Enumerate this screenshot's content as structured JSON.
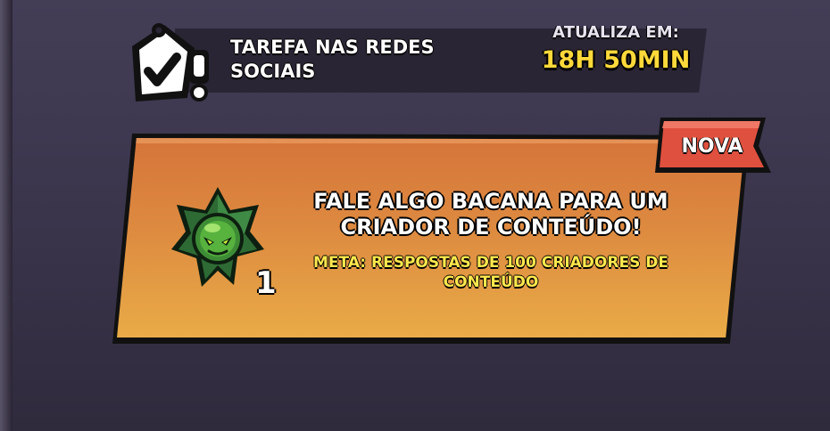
{
  "header": {
    "title": "TAREFA NAS REDES\nSOCIAIS",
    "timer_label": "ATUALIZA EM:",
    "timer_value": "18H 50MIN",
    "icon": "checkmark-tag-icon"
  },
  "quest": {
    "badge": "NOVA",
    "title": "FALE ALGO BACANA PARA UM CRIADOR DE CONTEÚDO!",
    "goal": "META: RESPOSTAS DE 100 CRIADORES DE CONTEÚDO",
    "reward_icon": "green-star-token-icon",
    "reward_count": "1"
  },
  "colors": {
    "background": "#3a344b",
    "card_orange": "#dd8a40",
    "badge_red": "#e0503e",
    "timer_yellow": "#ffd93a",
    "goal_yellow": "#ffe94d",
    "reward_green": "#2e7d32"
  }
}
